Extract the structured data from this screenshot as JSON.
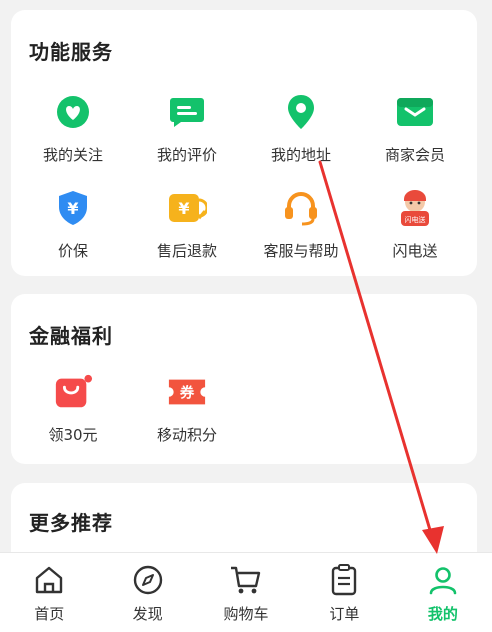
{
  "functions": {
    "title": "功能服务",
    "items": [
      {
        "label": "我的关注",
        "icon": "heart-icon"
      },
      {
        "label": "我的评价",
        "icon": "comment-icon"
      },
      {
        "label": "我的地址",
        "icon": "location-pin-icon"
      },
      {
        "label": "商家会员",
        "icon": "wallet-card-icon"
      },
      {
        "label": "价保",
        "icon": "shield-yen-icon"
      },
      {
        "label": "售后退款",
        "icon": "refund-yen-icon"
      },
      {
        "label": "客服与帮助",
        "icon": "headset-icon"
      },
      {
        "label": "闪电送",
        "icon": "courier-avatar-icon",
        "badge": "闪电送"
      }
    ]
  },
  "finance": {
    "title": "金融福利",
    "items": [
      {
        "label": "领30元",
        "icon": "shopping-bag-icon"
      },
      {
        "label": "移动积分",
        "icon": "coupon-icon",
        "badge": "券"
      }
    ]
  },
  "more": {
    "title": "更多推荐"
  },
  "nav": {
    "items": [
      {
        "label": "首页",
        "icon": "home-icon"
      },
      {
        "label": "发现",
        "icon": "compass-icon"
      },
      {
        "label": "购物车",
        "icon": "cart-icon"
      },
      {
        "label": "订单",
        "icon": "clipboard-icon"
      },
      {
        "label": "我的",
        "icon": "user-icon",
        "active": true
      }
    ]
  },
  "colors": {
    "brand_green": "#13c26b",
    "shield_blue": "#2f8cf2",
    "refund_yellow": "#f6b21c",
    "headset_orange": "#f7931e",
    "bag_red": "#f54b4b",
    "annotation_arrow": "#e8322f"
  }
}
